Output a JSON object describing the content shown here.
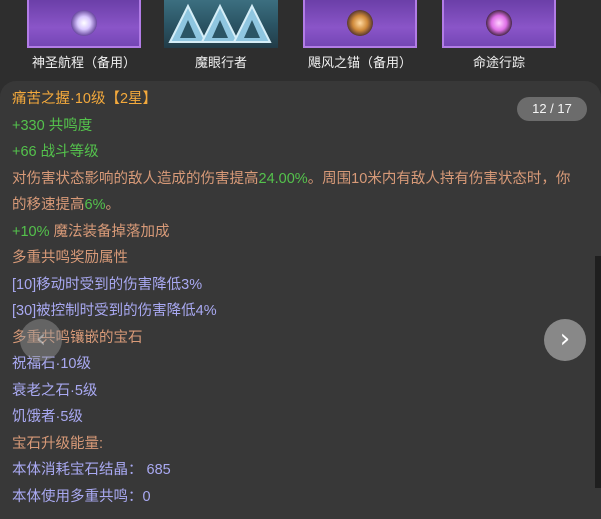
{
  "gems": [
    {
      "name": "神圣航程（备用）",
      "icon": "purple-star-gem-icon",
      "orb_color": "#d9c8ff"
    },
    {
      "name": "魔眼行者",
      "icon": "blue-triangle-gem-icon",
      "orb_color": "#9fd0e8"
    },
    {
      "name": "飓风之锚（备用）",
      "icon": "amber-anchor-gem-icon",
      "orb_color": "#d08a3a"
    },
    {
      "name": "命途行踪",
      "icon": "pink-orb-gem-icon",
      "orb_color": "#e070e8"
    }
  ],
  "counter": "12 / 17",
  "title": {
    "name": "痛苦之握",
    "dot": "·",
    "level": "10级",
    "stars": "【2星】"
  },
  "stats": [
    {
      "value": "+330",
      "label": " 共鸣度"
    },
    {
      "value": "+66",
      "label": " 战斗等级"
    }
  ],
  "effect": {
    "part1": "对伤害状态影响的敌人造成的伤害提高",
    "value1": "24.00%",
    "part2": "。周围10米内有敌人持有伤害状态时，你的移速提高",
    "value2": "6%",
    "part3": "。"
  },
  "drop_bonus": {
    "value": "+10%",
    "label": " 魔法装备掉落加成"
  },
  "resonance_title": "多重共鸣奖励属性",
  "resonance_items": [
    "[10]移动时受到的伤害降低3%",
    "[30]被控制时受到的伤害降低4%"
  ],
  "socket_title": "多重共鸣镶嵌的宝石",
  "socket_gems": [
    "祝福石·10级",
    "衰老之石·5级",
    "饥饿者·5级"
  ],
  "upgrade_title": "宝石升级能量:",
  "upgrade_lines": [
    {
      "label": "本体消耗宝石结晶：",
      "value": " 685"
    },
    {
      "label": "本体使用多重共鸣：",
      "value": "0"
    }
  ],
  "nav": {
    "prev": "‹",
    "next": "›"
  },
  "colors": {
    "title": "#f3a93c",
    "stat": "#54c24c",
    "text": "#d89a78",
    "link": "#a9a9f2"
  }
}
